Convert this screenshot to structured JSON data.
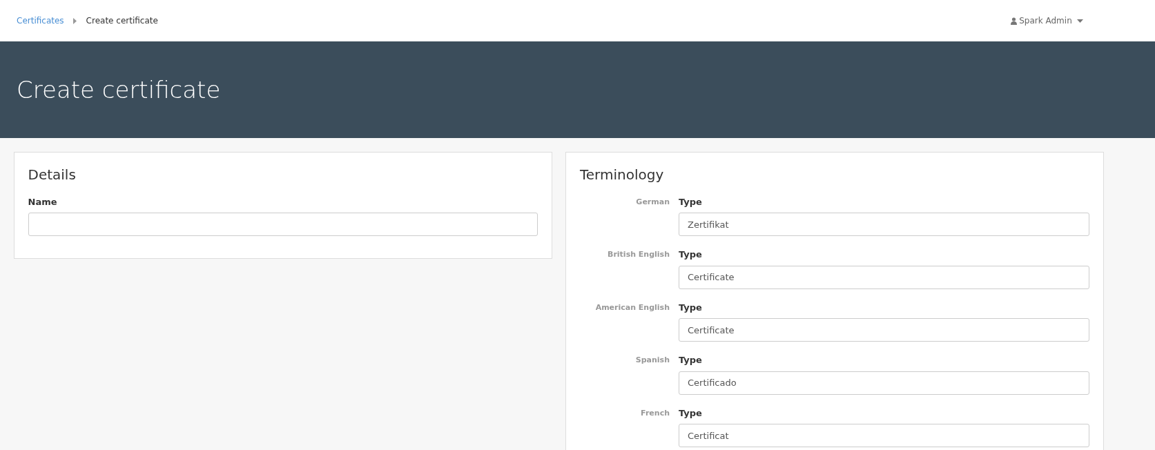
{
  "breadcrumb": [
    {
      "label": "Certificates",
      "kind": "link"
    },
    {
      "label": "Create certificate",
      "kind": "current"
    }
  ],
  "user_menu": {
    "label": "Spark Admin"
  },
  "page_title": "Create certificate",
  "details": {
    "title": "Details",
    "fields": [
      {
        "label": "Name"
      }
    ]
  },
  "terminology": {
    "title": "Terminology",
    "rows": [
      {
        "language": "German",
        "label": "Type",
        "value": "Zertifikat"
      },
      {
        "language": "British English",
        "label": "Type",
        "value": "Certificate"
      },
      {
        "language": "American English",
        "label": "Type",
        "value": "Certificate"
      },
      {
        "language": "Spanish",
        "label": "Type",
        "value": "Certificado"
      },
      {
        "language": "French",
        "label": "Type",
        "value": "Certificat"
      }
    ]
  }
}
